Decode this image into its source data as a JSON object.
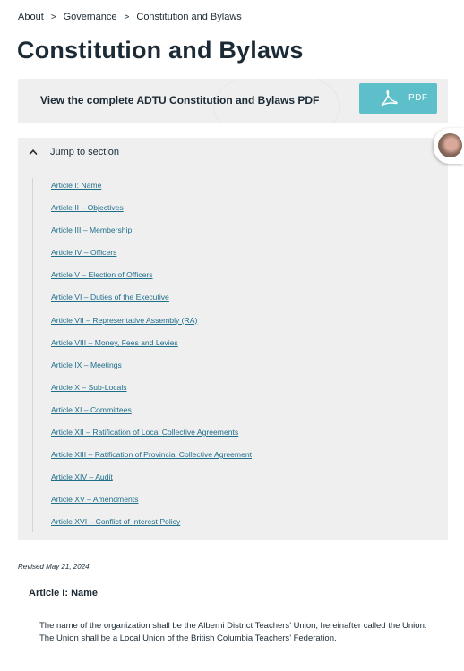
{
  "breadcrumb": {
    "items": [
      "About",
      "Governance",
      "Constitution and Bylaws"
    ],
    "separator": ">"
  },
  "page_title": "Constitution and Bylaws",
  "pdf_banner": {
    "text": "View the complete ADTU Constitution and Bylaws PDF",
    "button_label": "PDF",
    "button_color": "#5cbfc9",
    "icon": "acrobat-pdf-icon"
  },
  "jump_section": {
    "header": "Jump to section",
    "toggle_icon": "chevron-up-icon",
    "links": [
      "Article I: Name",
      "Article II – Objectives",
      "Article III – Membership",
      "Article IV – Officers",
      "Article V – Election of Officers",
      "Article VI – Duties of the Executive",
      "Article VII – Representative Assembly (RA)",
      "Article VIII – Money, Fees and Levies",
      "Article IX – Meetings",
      "Article X – Sub-Locals",
      "Article XI – Committees",
      "Article XII – Ratification of Local Collective Agreements",
      "Article XIII – Ratification of Provincial Collective Agreement",
      "Article XIV – Audit",
      "Article XV – Amendments",
      "Article XVI – Conflict of Interest Policy"
    ]
  },
  "revised": "Revised May 21, 2024",
  "article": {
    "heading": "Article I: Name",
    "body": "The name of the organization shall be the Alberni District Teachers’ Union, hereinafter called the Union. The Union shall be a Local Union of the British Columbia Teachers’ Federation."
  },
  "colors": {
    "text": "#1b2a35",
    "link": "#1f6f8b",
    "panel": "#efefef",
    "accent": "#5cbfc9"
  }
}
